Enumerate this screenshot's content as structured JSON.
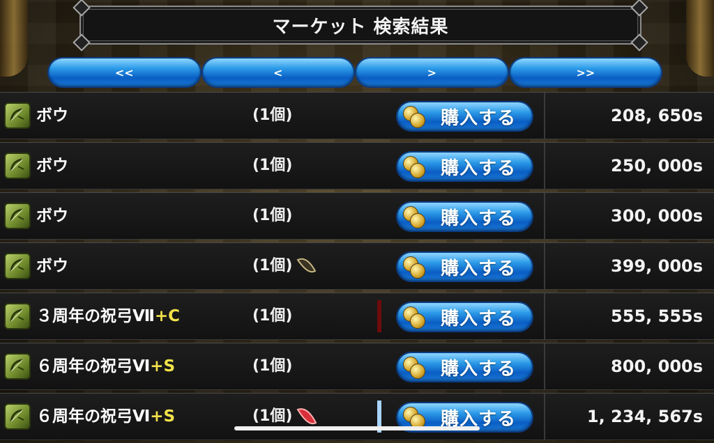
{
  "header": {
    "title": "マーケット 検索結果"
  },
  "pager": [
    {
      "label": "<<",
      "name": "first-page-button"
    },
    {
      "label": "<",
      "name": "prev-page-button"
    },
    {
      "label": ">",
      "name": "next-page-button"
    },
    {
      "label": ">>",
      "name": "last-page-button"
    }
  ],
  "buy_label": "購入する",
  "listings": [
    {
      "name": "ボウ",
      "suffix": "",
      "qty": "(1個)",
      "price": "208, 650s",
      "extra": "none"
    },
    {
      "name": "ボウ",
      "suffix": "",
      "qty": "(1個)",
      "price": "250, 000s",
      "extra": "none"
    },
    {
      "name": "ボウ",
      "suffix": "",
      "qty": "(1個)",
      "price": "300, 000s",
      "extra": "none"
    },
    {
      "name": "ボウ",
      "suffix": "",
      "qty": "(1個)",
      "price": "399, 000s",
      "extra": "stone-icon"
    },
    {
      "name": "３周年の祝弓Ⅶ",
      "suffix": "+C",
      "qty": "(1個)",
      "price": "555, 555s",
      "extra": "red-marker"
    },
    {
      "name": "６周年の祝弓Ⅵ",
      "suffix": "+S",
      "qty": "(1個)",
      "price": "800, 000s",
      "extra": "none"
    },
    {
      "name": "６周年の祝弓Ⅵ",
      "suffix": "+S",
      "qty": "(1個)",
      "price": "1, 234, 567s",
      "extra": "red-gem-icon"
    }
  ],
  "icons": {
    "item": "bow-icon",
    "buy": "coin-icon"
  },
  "colors": {
    "suffix": "#f2e24a",
    "button": "#1a78d6",
    "red_marker": "#6e0b0b",
    "blue_marker": "#a9d4ff"
  }
}
